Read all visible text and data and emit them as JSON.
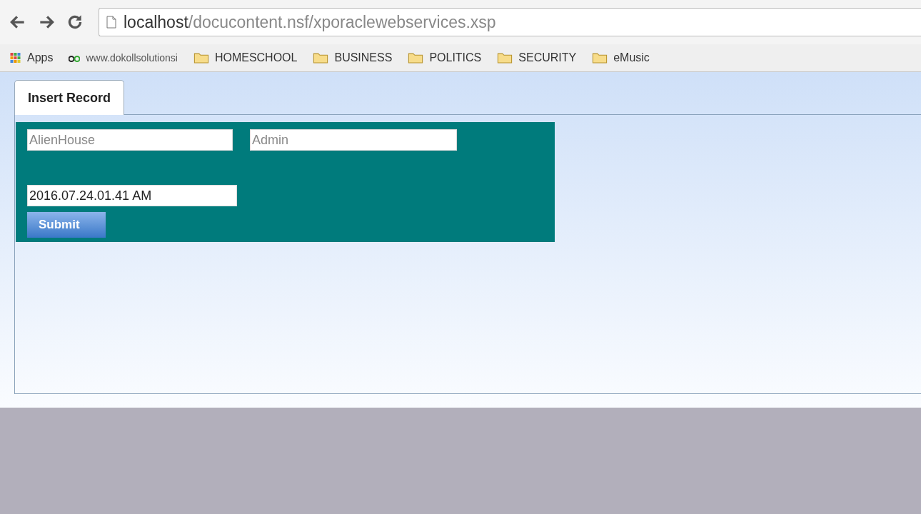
{
  "browser": {
    "url_host": "localhost",
    "url_path": "/docucontent.nsf/xporaclewebservices.xsp"
  },
  "bookmarks": [
    {
      "kind": "apps",
      "label": "Apps"
    },
    {
      "kind": "site",
      "label": "www.dokollsolutionsi"
    },
    {
      "kind": "folder",
      "label": "HOMESCHOOL"
    },
    {
      "kind": "folder",
      "label": "BUSINESS"
    },
    {
      "kind": "folder",
      "label": "POLITICS"
    },
    {
      "kind": "folder",
      "label": "SECURITY"
    },
    {
      "kind": "folder",
      "label": "eMusic"
    }
  ],
  "tabs": [
    {
      "label": "Insert Record",
      "selected": true
    }
  ],
  "form": {
    "fields": [
      {
        "placeholder": "AlienHouse"
      },
      {
        "placeholder": "Admin"
      },
      {
        "value": "2016.07.24.01.41 AM"
      }
    ],
    "submit": "Submit"
  }
}
